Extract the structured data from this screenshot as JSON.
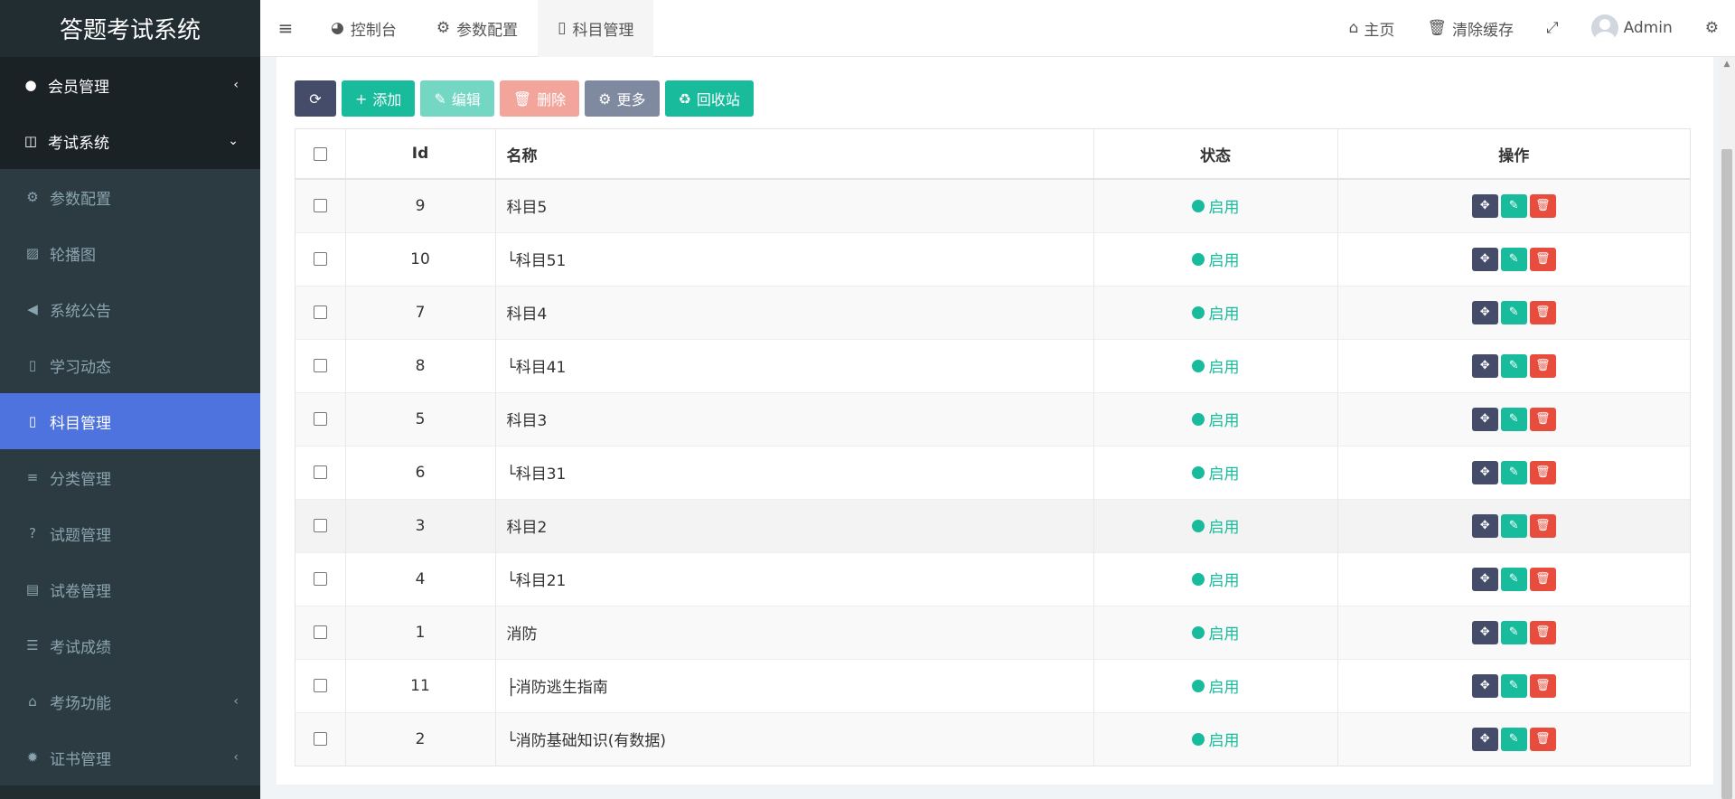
{
  "sidebar": {
    "logo": "答题考试系统",
    "menu": [
      {
        "label": "会员管理",
        "icon": "user-circle-icon",
        "glyph": "●",
        "chevron": "‹"
      },
      {
        "label": "考试系统",
        "icon": "columns-icon",
        "glyph": "◫",
        "chevron": "⌄"
      },
      {
        "label": "参数配置",
        "icon": "cogs-icon",
        "glyph": "⚙"
      },
      {
        "label": "轮播图",
        "icon": "image-icon",
        "glyph": "▨"
      },
      {
        "label": "系统公告",
        "icon": "volume-icon",
        "glyph": "◀"
      },
      {
        "label": "学习动态",
        "icon": "map-icon",
        "glyph": "▯"
      },
      {
        "label": "科目管理",
        "icon": "map-icon",
        "glyph": "▯"
      },
      {
        "label": "分类管理",
        "icon": "align-left-icon",
        "glyph": "≡"
      },
      {
        "label": "试题管理",
        "icon": "question-circle-icon",
        "glyph": "?"
      },
      {
        "label": "试卷管理",
        "icon": "newspaper-icon",
        "glyph": "▤"
      },
      {
        "label": "考试成绩",
        "icon": "list-icon",
        "glyph": "☰"
      },
      {
        "label": "考场功能",
        "icon": "home-icon",
        "glyph": "⌂",
        "chevron": "‹"
      },
      {
        "label": "证书管理",
        "icon": "certificate-icon",
        "glyph": "✹",
        "chevron": "‹"
      }
    ]
  },
  "topnav": {
    "tabs": [
      {
        "label": "控制台",
        "icon": "dashboard-icon",
        "glyph": "◕"
      },
      {
        "label": "参数配置",
        "icon": "cogs-icon",
        "glyph": "⚙"
      },
      {
        "label": "科目管理",
        "icon": "map-icon",
        "glyph": "▯"
      }
    ],
    "home": "主页",
    "clear_cache": "清除缓存",
    "user": "Admin",
    "menu_glyph": "≡",
    "home_glyph": "⌂",
    "trash_glyph": "🗑",
    "fullscreen_glyph": "⤢",
    "settings_glyph": "⚙"
  },
  "toolbar": {
    "refresh_glyph": "⟳",
    "add": "添加",
    "edit": "编辑",
    "delete": "删除",
    "more": "更多",
    "recycle": "回收站",
    "add_glyph": "+",
    "edit_glyph": "✎",
    "delete_glyph": "🗑",
    "more_glyph": "⚙",
    "recycle_glyph": "♻"
  },
  "table": {
    "headers": {
      "id": "Id",
      "name": "名称",
      "status": "状态",
      "ops": "操作"
    },
    "rows": [
      {
        "id": "9",
        "name": "科目5",
        "status": "启用"
      },
      {
        "id": "10",
        "name": "└科目51",
        "status": "启用"
      },
      {
        "id": "7",
        "name": "科目4",
        "status": "启用"
      },
      {
        "id": "8",
        "name": "└科目41",
        "status": "启用"
      },
      {
        "id": "5",
        "name": "科目3",
        "status": "启用"
      },
      {
        "id": "6",
        "name": "└科目31",
        "status": "启用"
      },
      {
        "id": "3",
        "name": "科目2",
        "status": "启用"
      },
      {
        "id": "4",
        "name": "└科目21",
        "status": "启用"
      },
      {
        "id": "1",
        "name": "消防",
        "status": "启用"
      },
      {
        "id": "11",
        "name": "├消防逃生指南",
        "status": "启用"
      },
      {
        "id": "2",
        "name": "└消防基础知识(有数据)",
        "status": "启用"
      }
    ],
    "op_glyphs": {
      "move": "✥",
      "edit": "✎",
      "delete": "🗑"
    }
  },
  "colors": {
    "sidebar_bg": "#222d32",
    "active_menu": "#4e73df",
    "success": "#18bc9c",
    "danger": "#e74c3c",
    "dark_btn": "#444c69"
  }
}
